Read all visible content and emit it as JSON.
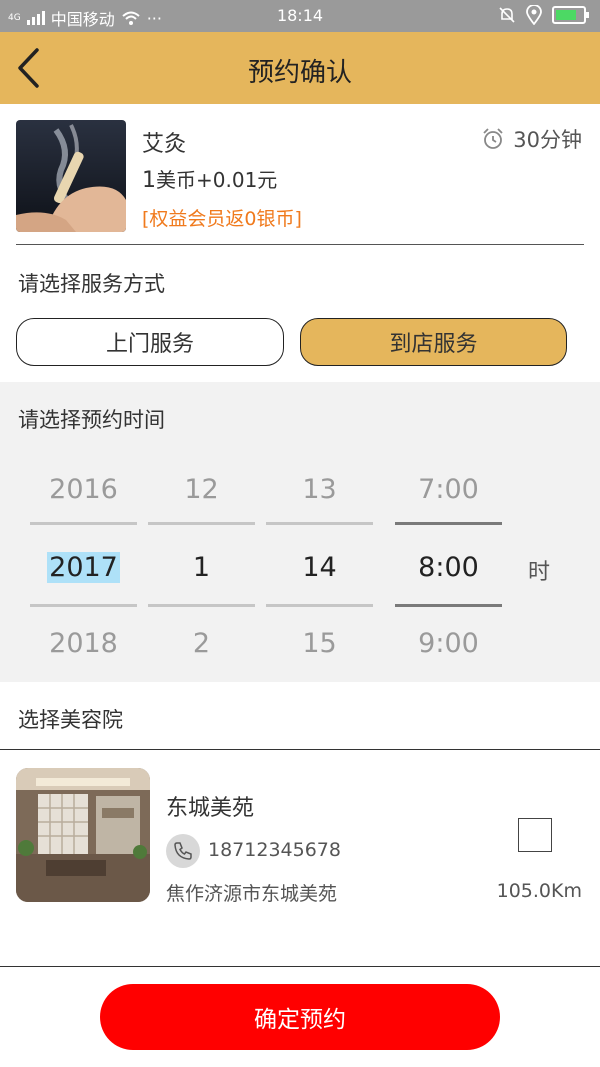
{
  "status_bar": {
    "network": "4G",
    "carrier": "中国移动",
    "extra": "···",
    "time": "18:14"
  },
  "nav": {
    "title": "预约确认"
  },
  "product": {
    "name": "艾灸",
    "price_coin": "1",
    "price_rest": "美币+0.01元",
    "rebate": "[权益会员返0银币]",
    "duration": "30分钟"
  },
  "service": {
    "label": "请选择服务方式",
    "home_label": "上门服务",
    "store_label": "到店服务",
    "selected": "到店服务"
  },
  "time_picker": {
    "label": "请选择预约时间",
    "year": {
      "prev": "2016",
      "selected": "2017",
      "next": "2018"
    },
    "month": {
      "prev": "12",
      "selected": "1",
      "next": "2"
    },
    "day": {
      "prev": "13",
      "selected": "14",
      "next": "15"
    },
    "hour": {
      "prev": "7:00",
      "selected": "8:00",
      "next": "9:00"
    },
    "hour_unit": "时"
  },
  "salon_section": {
    "label": "选择美容院",
    "salons": [
      {
        "name": "东城美苑",
        "phone": "18712345678",
        "address": "焦作济源市东城美苑",
        "distance": "105.0Km",
        "checked": false
      }
    ]
  },
  "confirm": {
    "label": "确定预约"
  },
  "colors": {
    "accent": "#e5b65c",
    "confirm": "#ff0000",
    "rebate": "#f07a1d",
    "status_bar": "#9a9a9a",
    "picker_bg": "#f2f2f2"
  }
}
